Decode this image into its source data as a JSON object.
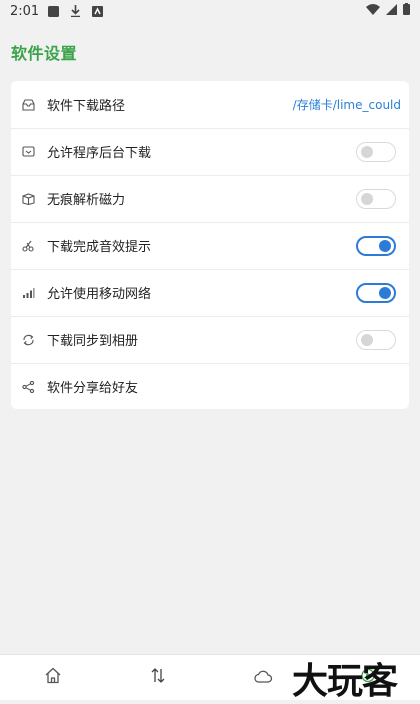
{
  "statusbar": {
    "time": "2:01"
  },
  "page": {
    "title": "软件设置"
  },
  "settings": {
    "download_path": {
      "label": "软件下载路径",
      "value": "/存储卡/lime_could",
      "icon": "inbox-icon"
    },
    "background_download": {
      "label": "允许程序后台下载",
      "enabled": false,
      "icon": "tv-icon"
    },
    "magnet_parse": {
      "label": "无痕解析磁力",
      "enabled": false,
      "icon": "box-icon"
    },
    "download_sound": {
      "label": "下载完成音效提示",
      "enabled": true,
      "icon": "scissors-icon"
    },
    "mobile_network": {
      "label": "允许使用移动网络",
      "enabled": true,
      "icon": "signal-icon"
    },
    "sync_album": {
      "label": "下载同步到相册",
      "enabled": false,
      "icon": "sync-icon"
    },
    "share": {
      "label": "软件分享给好友",
      "icon": "share-icon"
    }
  },
  "bottom_nav": {
    "items": [
      "home-icon",
      "sort-icon",
      "cloud-icon",
      "settings-icon"
    ]
  },
  "watermark": {
    "text": "大玩客"
  },
  "colors": {
    "accent_green": "#3aa34a",
    "toggle_blue": "#2d7bd6",
    "path_blue": "#2a7fd8"
  }
}
